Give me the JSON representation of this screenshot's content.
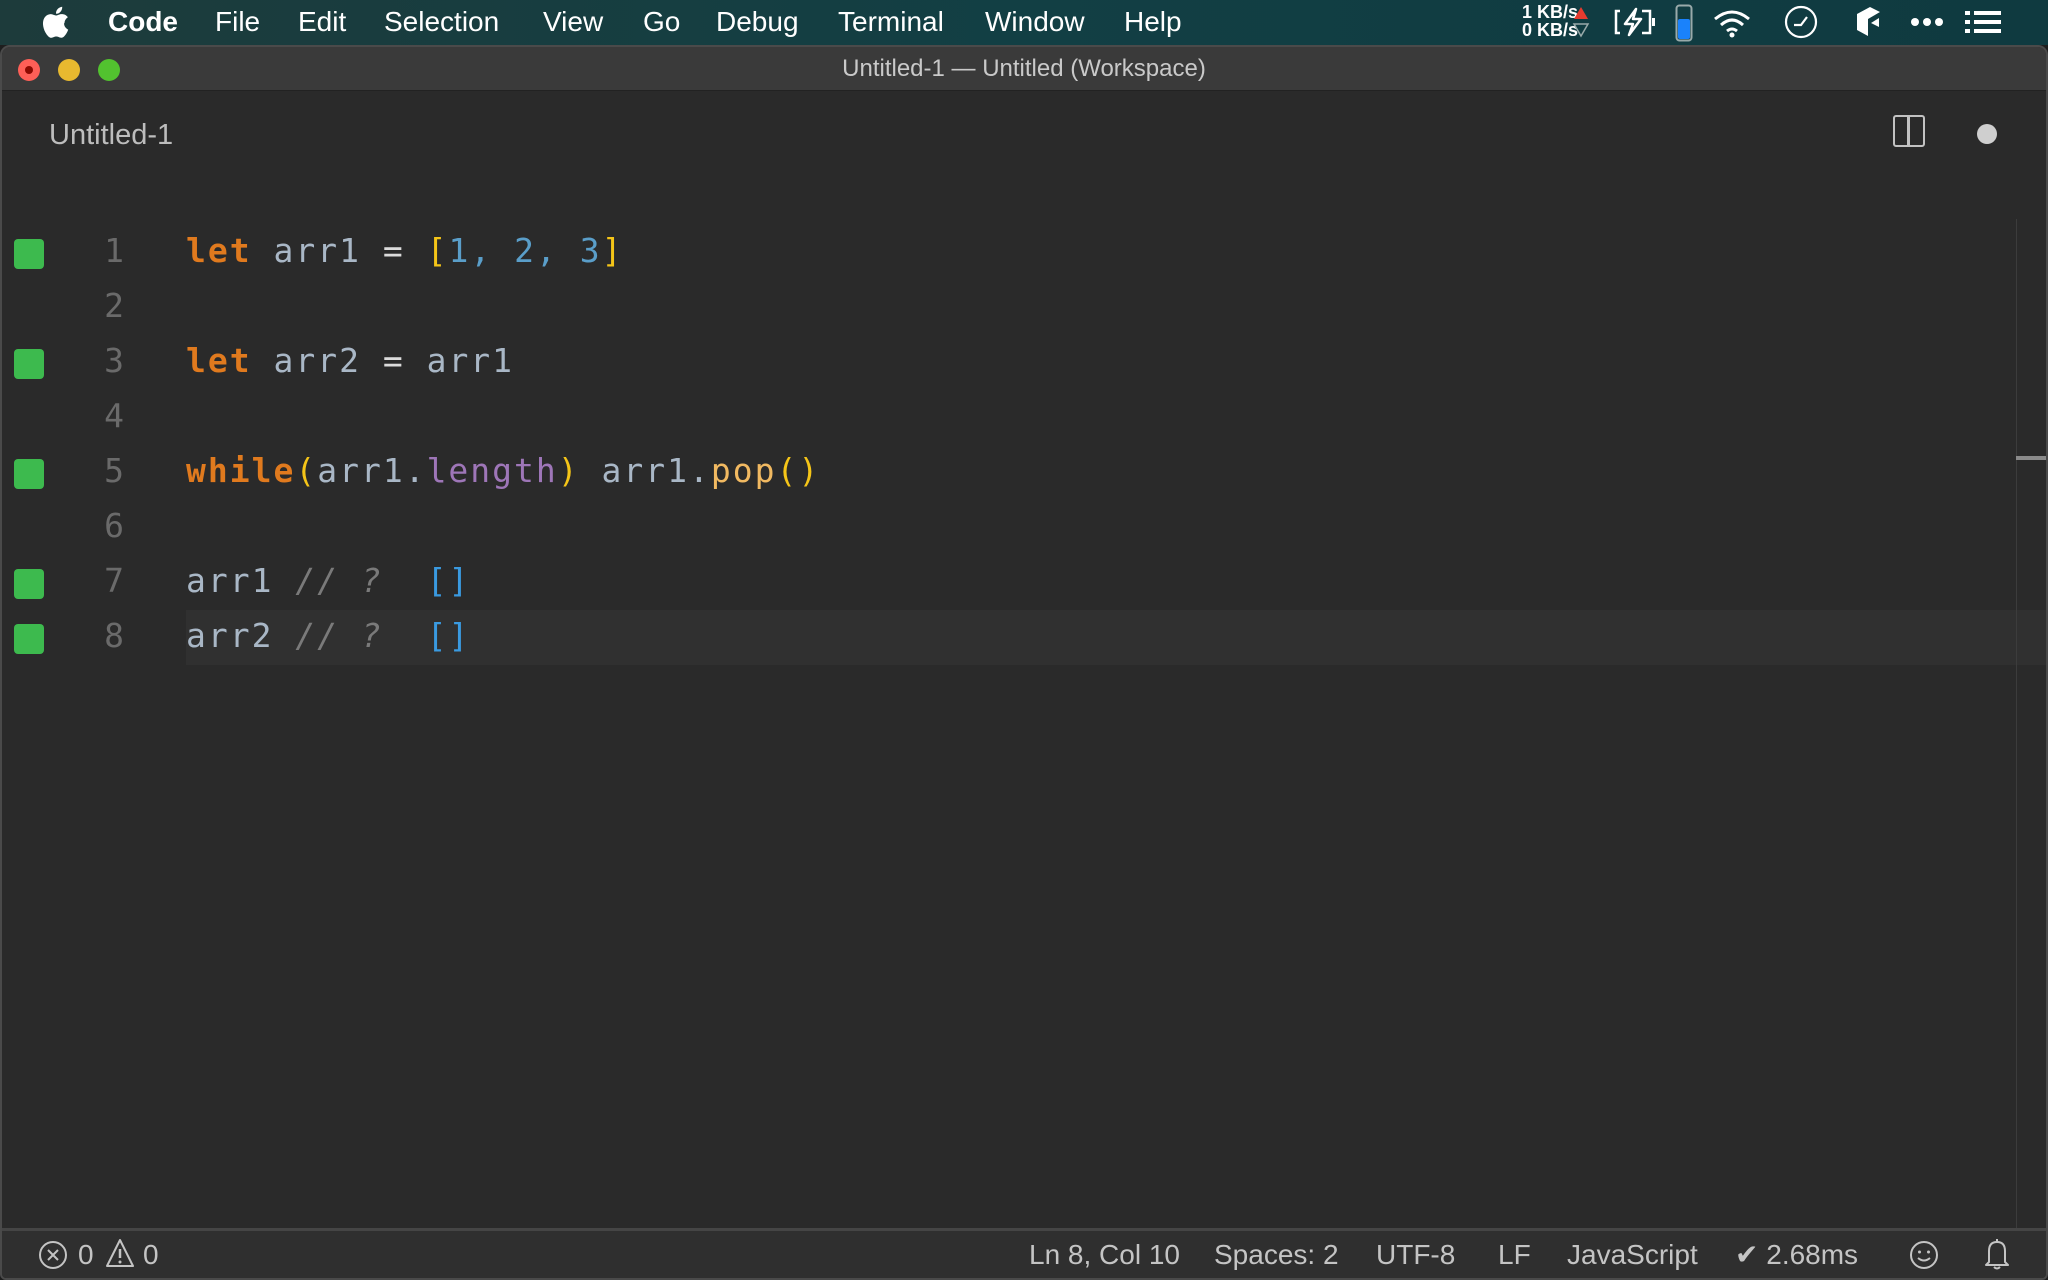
{
  "menubar": {
    "apple_icon": "apple-icon",
    "app_name": "Code",
    "items": [
      "File",
      "Edit",
      "Selection",
      "View",
      "Go",
      "Debug",
      "Terminal",
      "Window",
      "Help"
    ],
    "network": {
      "up": "1 KB/s",
      "down": "0 KB/s"
    },
    "tray_icons": [
      "network-arrows-icon",
      "battery-charging-icon",
      "battery-level-icon",
      "wifi-icon",
      "clock-icon",
      "app-cube-icon",
      "more-icon",
      "list-icon"
    ]
  },
  "window": {
    "title": "Untitled-1 — Untitled (Workspace)",
    "tab": {
      "label": "Untitled-1",
      "dirty": true
    }
  },
  "editor": {
    "lines": [
      {
        "num": "1",
        "marker": true,
        "tokens": [
          {
            "t": "let",
            "c": "kw"
          },
          {
            "t": " ",
            "c": "id"
          },
          {
            "t": "arr1",
            "c": "id"
          },
          {
            "t": " = ",
            "c": "op"
          },
          {
            "t": "[",
            "c": "br"
          },
          {
            "t": "1",
            "c": "num"
          },
          {
            "t": ", ",
            "c": "num"
          },
          {
            "t": "2",
            "c": "num"
          },
          {
            "t": ", ",
            "c": "num"
          },
          {
            "t": "3",
            "c": "num"
          },
          {
            "t": "]",
            "c": "br"
          }
        ]
      },
      {
        "num": "2",
        "marker": false,
        "tokens": []
      },
      {
        "num": "3",
        "marker": true,
        "tokens": [
          {
            "t": "let",
            "c": "kw"
          },
          {
            "t": " arr2 ",
            "c": "id"
          },
          {
            "t": "=",
            "c": "op"
          },
          {
            "t": " arr1",
            "c": "id"
          }
        ]
      },
      {
        "num": "4",
        "marker": false,
        "tokens": []
      },
      {
        "num": "5",
        "marker": true,
        "tokens": [
          {
            "t": "while",
            "c": "kw"
          },
          {
            "t": "(",
            "c": "br"
          },
          {
            "t": "arr1.",
            "c": "id"
          },
          {
            "t": "length",
            "c": "prop"
          },
          {
            "t": ")",
            "c": "br"
          },
          {
            "t": " arr1.",
            "c": "id"
          },
          {
            "t": "pop",
            "c": "fn"
          },
          {
            "t": "()",
            "c": "br"
          }
        ]
      },
      {
        "num": "6",
        "marker": false,
        "tokens": []
      },
      {
        "num": "7",
        "marker": true,
        "tokens": [
          {
            "t": "arr1",
            "c": "id"
          },
          {
            "t": " // ? ",
            "c": "cm"
          },
          {
            "t": " []",
            "c": "res"
          }
        ]
      },
      {
        "num": "8",
        "marker": true,
        "current": true,
        "tokens": [
          {
            "t": "arr2",
            "c": "id"
          },
          {
            "t": " // ? ",
            "c": "cm"
          },
          {
            "t": " []",
            "c": "res"
          }
        ]
      }
    ]
  },
  "statusbar": {
    "errors": "0",
    "warnings": "0",
    "cursor": "Ln 8, Col 10",
    "indent": "Spaces: 2",
    "encoding": "UTF-8",
    "eol": "LF",
    "language": "JavaScript",
    "timing": "✔ 2.68ms"
  },
  "colors": {
    "marker_green": "#3dba4e",
    "keyword": "#e07a1e",
    "bracket": "#f5c518",
    "number": "#5a9ec9",
    "property": "#9e76b8",
    "result": "#3a9ae0"
  }
}
